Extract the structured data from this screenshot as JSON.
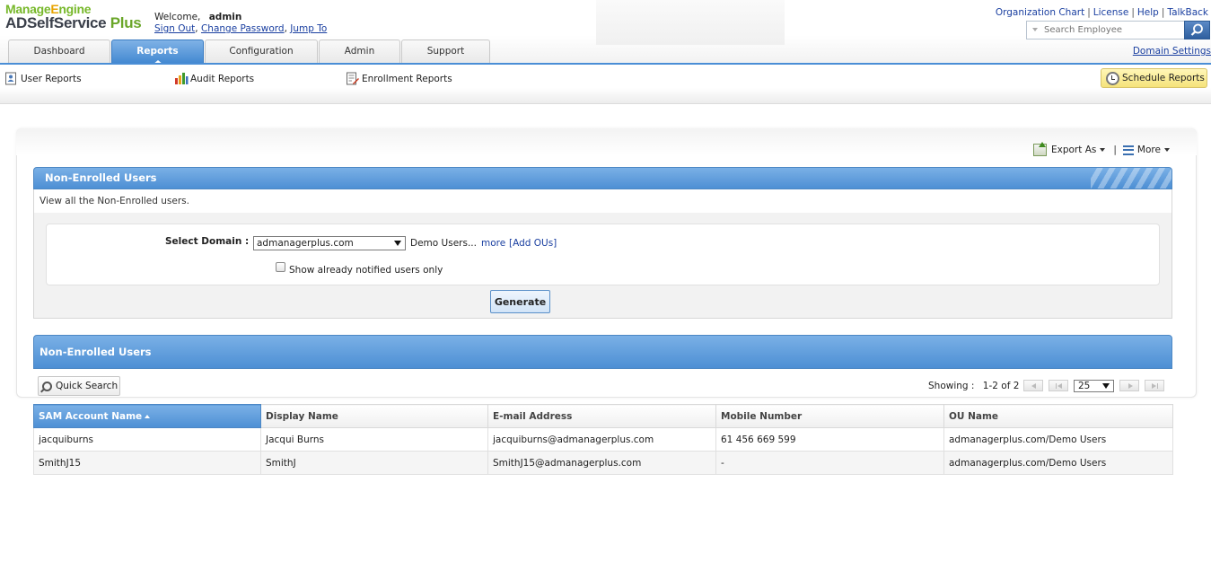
{
  "brand": {
    "company": "ManageEngine",
    "product": "ADSelfService",
    "product_suffix": "Plus"
  },
  "header": {
    "welcome_label": "Welcome,",
    "user_name": "admin",
    "sign_out": "Sign Out",
    "change_password": "Change Password",
    "jump_to": "Jump To",
    "top_links": [
      "Organization Chart",
      "License",
      "Help",
      "TalkBack"
    ],
    "search_placeholder": "Search Employee",
    "domain_settings": "Domain Settings"
  },
  "tabs": [
    {
      "label": "Dashboard",
      "active": false
    },
    {
      "label": "Reports",
      "active": true
    },
    {
      "label": "Configuration",
      "active": false
    },
    {
      "label": "Admin",
      "active": false
    },
    {
      "label": "Support",
      "active": false
    }
  ],
  "subnav": {
    "user_reports": "User Reports",
    "audit_reports": "Audit Reports",
    "enrollment_reports": "Enrollment Reports",
    "schedule_reports": "Schedule Reports"
  },
  "actions": {
    "export_as": "Export As",
    "separator": "|",
    "more": "More"
  },
  "filter_panel": {
    "title": "Non-Enrolled Users",
    "description": "View all the Non-Enrolled users.",
    "select_domain_label": "Select Domain :",
    "domain_value": "admanagerplus.com",
    "ou_text": "Demo Users...",
    "more_link": "more",
    "add_ous_link": "[Add OUs]",
    "notified_label": "Show already notified users only",
    "notified_checked": false,
    "generate_button": "Generate"
  },
  "results_panel": {
    "title": "Non-Enrolled Users",
    "quick_search": "Quick Search",
    "showing_label": "Showing :",
    "showing_range": "1-2 of 2",
    "page_size": "25",
    "columns": [
      "SAM Account Name",
      "Display Name",
      "E-mail Address",
      "Mobile Number",
      "OU Name"
    ],
    "sorted_column": "SAM Account Name",
    "rows": [
      [
        "jacquiburns",
        "Jacqui Burns",
        "jacquiburns@admanagerplus.com",
        "61 456 669 599",
        "admanagerplus.com/Demo Users"
      ],
      [
        "SmithJ15",
        "SmithJ",
        "SmithJ15@admanagerplus.com",
        "-",
        "admanagerplus.com/Demo Users"
      ]
    ]
  },
  "colors": {
    "accent_blue": "#4d8fd4",
    "brand_green": "#77b82a",
    "schedule_yellow": "#f5e37a",
    "link_blue": "#1a3fa0"
  }
}
